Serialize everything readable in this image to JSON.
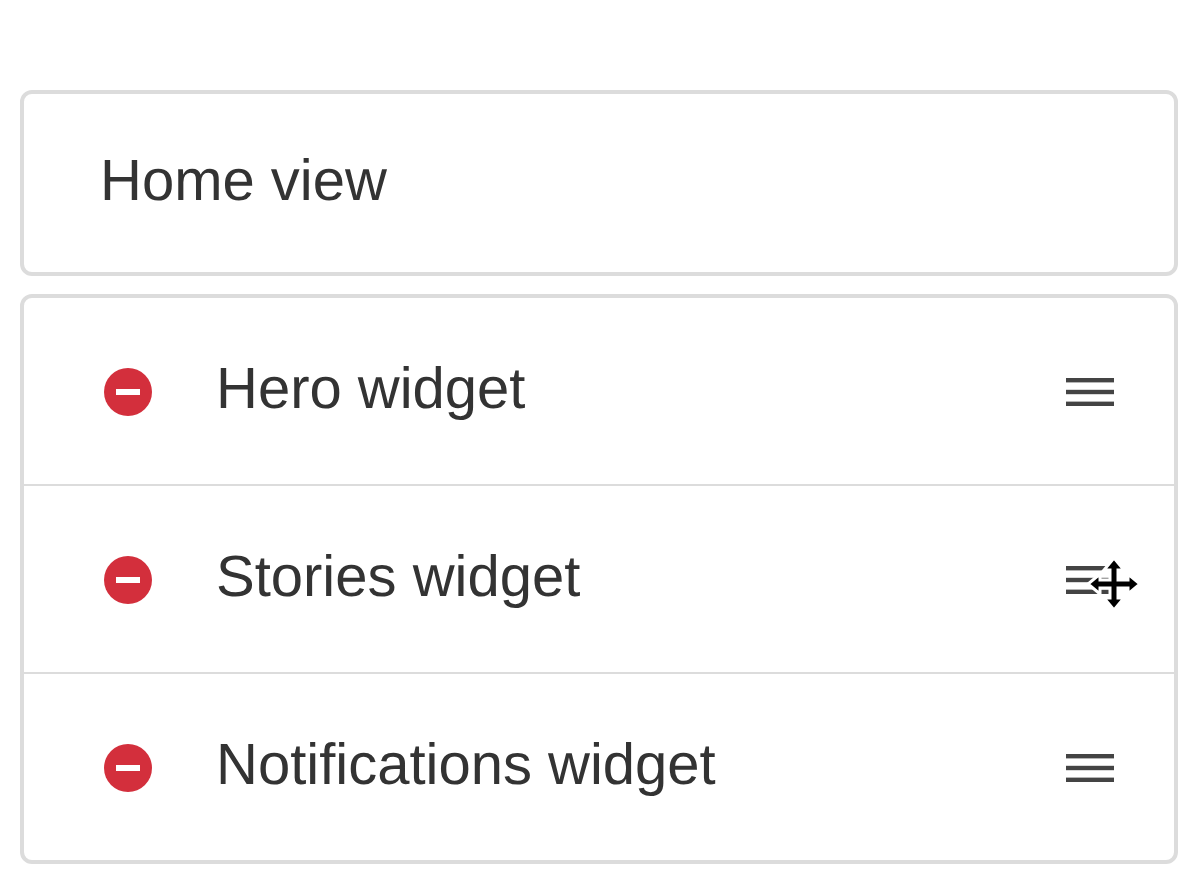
{
  "header": {
    "title": "Home view"
  },
  "widgets": [
    {
      "name": "Hero widget",
      "hovered": false
    },
    {
      "name": "Stories widget",
      "hovered": true
    },
    {
      "name": "Notifications widget",
      "hovered": false
    }
  ]
}
